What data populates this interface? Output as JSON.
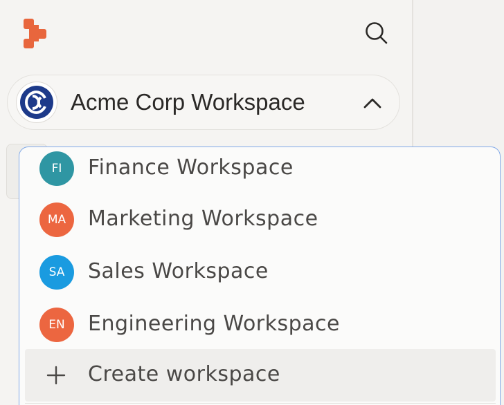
{
  "colors": {
    "logo": "#e8663d",
    "sidebar_bg": "#f5f4f2",
    "dropdown_border": "#7fa8e8",
    "workspace_logo_navy": "#1d3a8a"
  },
  "header": {
    "logo_icon": "brand-logo-icon",
    "search_icon": "search-icon"
  },
  "workspace_switcher": {
    "current_name": "Acme Corp Workspace",
    "chevron_icon": "chevron-up-icon"
  },
  "dropdown": {
    "items": [
      {
        "initials": "FI",
        "label": "Finance Workspace",
        "color": "#2f96a3"
      },
      {
        "initials": "MA",
        "label": "Marketing Workspace",
        "color": "#ec6640"
      },
      {
        "initials": "SA",
        "label": "Sales Workspace",
        "color": "#1a9be0"
      },
      {
        "initials": "EN",
        "label": "Engineering Workspace",
        "color": "#ec6640"
      }
    ],
    "create_label": "Create workspace",
    "create_icon": "plus-icon"
  }
}
